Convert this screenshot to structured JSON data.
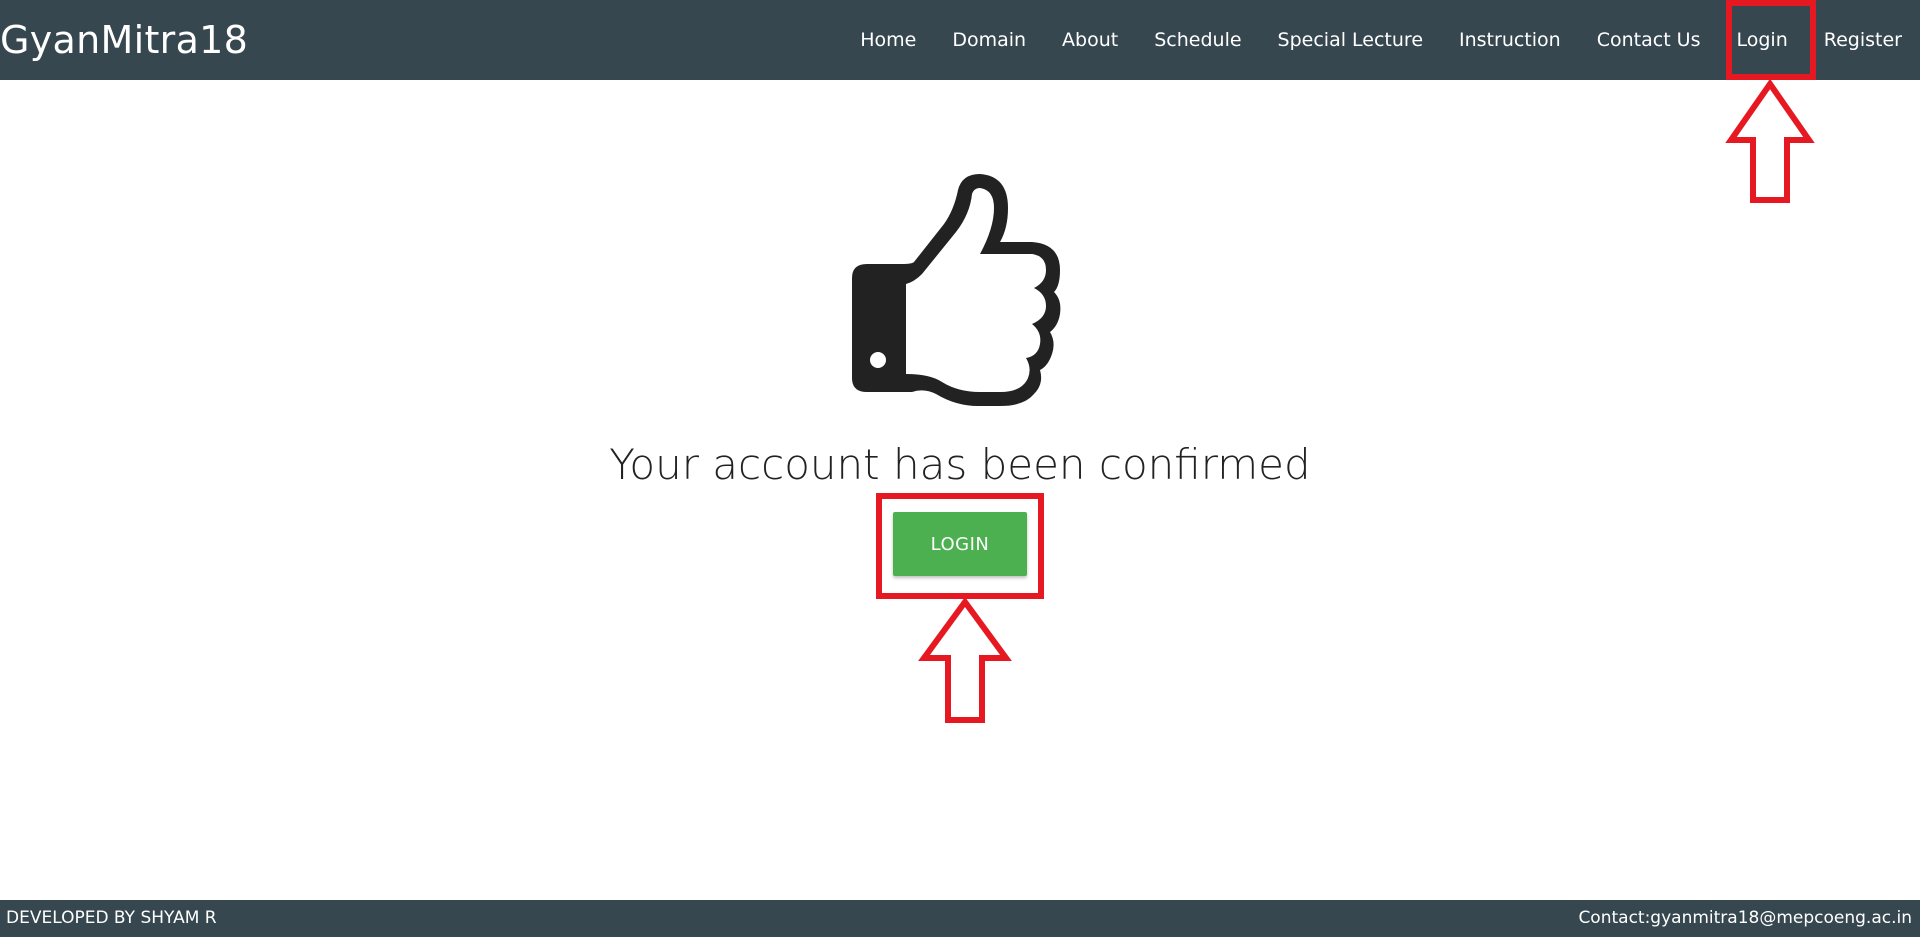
{
  "navbar": {
    "brand": "GyanMitra18",
    "links": [
      "Home",
      "Domain",
      "About",
      "Schedule",
      "Special Lecture",
      "Instruction",
      "Contact Us",
      "Login",
      "Register"
    ]
  },
  "main": {
    "icon": "thumbs-up-icon",
    "message": "Your account has been confirmed",
    "login_button": "LOGIN"
  },
  "footer": {
    "left": "DEVELOPED BY SHYAM R",
    "right": "Contact:gyanmitra18@mepcoeng.ac.in"
  },
  "colors": {
    "navbar_bg": "#37474f",
    "button_green": "#4caf50",
    "annotation_red": "#e61922"
  }
}
